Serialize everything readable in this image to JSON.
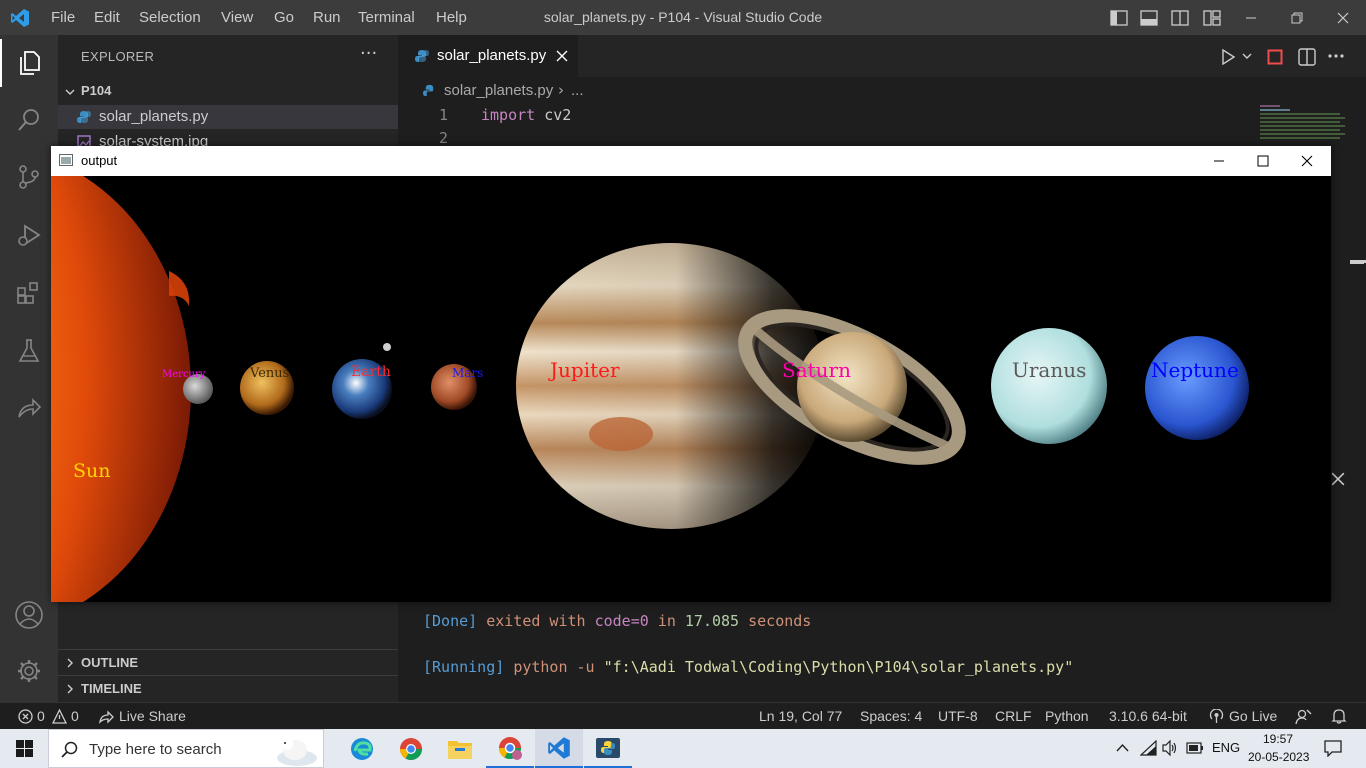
{
  "app": {
    "window_title": "solar_planets.py - P104 - Visual Studio Code",
    "menu": [
      "File",
      "Edit",
      "Selection",
      "View",
      "Go",
      "Run",
      "Terminal",
      "Help"
    ]
  },
  "sidebar": {
    "title": "EXPLORER",
    "more": "···",
    "folder": "P104",
    "files": [
      {
        "name": "solar_planets.py",
        "icon": "python-icon",
        "selected": true
      },
      {
        "name": "solar-system.jpg",
        "icon": "image-icon",
        "selected": false
      }
    ],
    "sections": [
      {
        "label": "OUTLINE"
      },
      {
        "label": "TIMELINE"
      }
    ]
  },
  "editor": {
    "tab_label": "solar_planets.py",
    "breadcrumb_file": "solar_planets.py",
    "breadcrumb_more": "...",
    "lines": [
      {
        "no": "1",
        "keyword": "import",
        "rest": " cv2"
      },
      {
        "no": "2",
        "keyword": "",
        "rest": ""
      }
    ]
  },
  "terminal": {
    "done_tag": "[Done]",
    "done_text": "exited with",
    "done_code": "code=0",
    "done_in": "in",
    "done_seconds": "17.085",
    "done_unit": "seconds",
    "running_tag": "[Running]",
    "running_cmd": "python -u",
    "running_path": "\"f:\\Aadi Todwal\\Coding\\Python\\P104\\solar_planets.py\""
  },
  "statusbar": {
    "errors": "0",
    "warnings": "0",
    "live_share": "Live Share",
    "position": "Ln 19, Col 77",
    "spaces": "Spaces: 4",
    "encoding": "UTF-8",
    "eol": "CRLF",
    "language": "Python",
    "interpreter": "3.10.6 64-bit",
    "go_live": "Go Live"
  },
  "output_window": {
    "title": "output",
    "labels": {
      "sun": "Sun",
      "mercury": "Mercury",
      "venus": "Venus",
      "earth": "Earth",
      "mars": "Mars",
      "jupiter": "Jupiter",
      "saturn": "Saturn",
      "uranus": "Uranus",
      "neptune": "Neptune"
    },
    "label_colors": {
      "sun": "#ffd400",
      "mercury": "#ff00ff",
      "venus": "#3a2a00",
      "earth": "#ff2a2a",
      "mars": "#1a1aff",
      "jupiter": "#ff1a1a",
      "saturn": "#ff00aa",
      "uranus": "#5a5a5a",
      "neptune": "#0000ff"
    }
  },
  "taskbar": {
    "search_placeholder": "Type here to search",
    "language": "ENG",
    "time": "19:57",
    "date": "20-05-2023"
  }
}
